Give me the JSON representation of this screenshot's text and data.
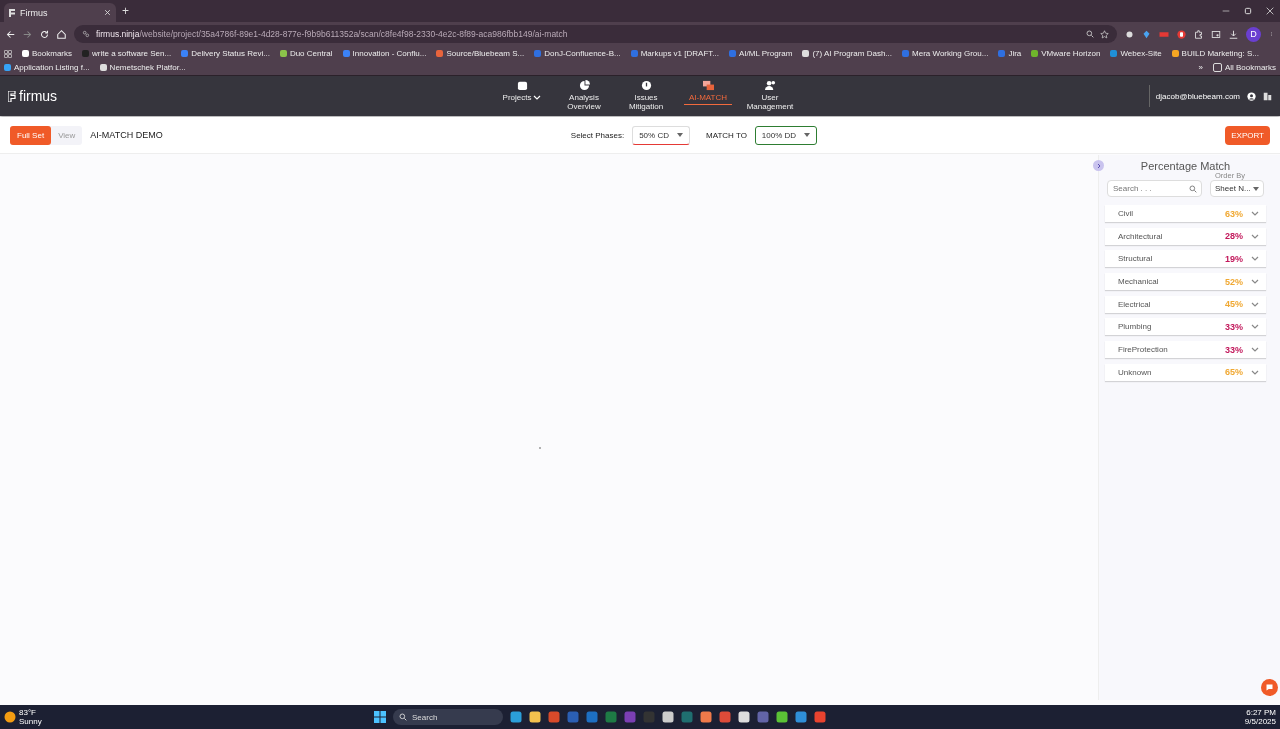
{
  "browser": {
    "tab_title": "Firmus",
    "new_tab": "+",
    "url_host": "firmus.ninja",
    "url_path": "/website/project/35a4786f-89e1-4d28-877e-f9b9b611352a/scan/c8fe4f98-2330-4e2c-8f89-aca986fbb149/ai-match",
    "profile": "D",
    "bookmarks": [
      "Bookmarks",
      "write a software Sen...",
      "Delivery Status Revi...",
      "Duo Central",
      "Innovation - Conflu...",
      "Source/Bluebeam S...",
      "DonJ-Confluence-B...",
      "Markups v1 [DRAFT...",
      "AI/ML Program",
      "(7) AI Program Dash...",
      "Mera Working Grou...",
      "Jira",
      "VMware Horizon",
      "Webex-Site",
      "BUILD Marketing: S...",
      "Application Listing f...",
      "Nemetschek Platfor..."
    ],
    "more": "»",
    "all_bookmarks": "All Bookmarks"
  },
  "app": {
    "logo": "firmus",
    "nav": [
      {
        "label": "Projects",
        "selected": false,
        "dropdown": true
      },
      {
        "label": "Analysis Overview",
        "selected": false,
        "dropdown": false
      },
      {
        "label": "Issues Mitigation",
        "selected": false,
        "dropdown": false
      },
      {
        "label": "AI-MATCH",
        "selected": true,
        "dropdown": false
      },
      {
        "label": "User Management",
        "selected": false,
        "dropdown": false
      }
    ],
    "user": "djacob@bluebeam.com"
  },
  "toolbar": {
    "modes": [
      {
        "label": "Full Set",
        "selected": true
      },
      {
        "label": "View",
        "selected": false
      }
    ],
    "title": "AI-MATCH DEMO",
    "phases_label": "Select Phases:",
    "phase": "50% CD",
    "match_label": "MATCH TO",
    "match": "100% DD",
    "export": "EXPORT"
  },
  "panel": {
    "title": "Percentage Match",
    "search": {
      "placeholder": "Search . . ."
    },
    "order_by": {
      "label": "Order By",
      "value": "Sheet N..."
    },
    "categories": [
      {
        "name": "Civil",
        "percent": "63%",
        "color": "#f0a832",
        "expanded": false
      },
      {
        "name": "Architectural",
        "percent": "28%",
        "color": "#c2185b",
        "expanded": false
      },
      {
        "name": "Structural",
        "percent": "19%",
        "color": "#c2185b",
        "expanded": false
      },
      {
        "name": "Mechanical",
        "percent": "52%",
        "color": "#f0a832",
        "expanded": false
      },
      {
        "name": "Electrical",
        "percent": "45%",
        "color": "#f0a832",
        "expanded": false
      },
      {
        "name": "Plumbing",
        "percent": "33%",
        "color": "#c2185b",
        "expanded": false
      },
      {
        "name": "FireProtection",
        "percent": "33%",
        "color": "#c2185b",
        "expanded": false
      },
      {
        "name": "Unknown",
        "percent": "65%",
        "color": "#f0a832",
        "expanded": false
      }
    ]
  },
  "taskbar": {
    "temperature": "83°F",
    "weather": "Sunny",
    "search": "Search",
    "time": "6:27 PM",
    "date": "9/5/2025"
  }
}
